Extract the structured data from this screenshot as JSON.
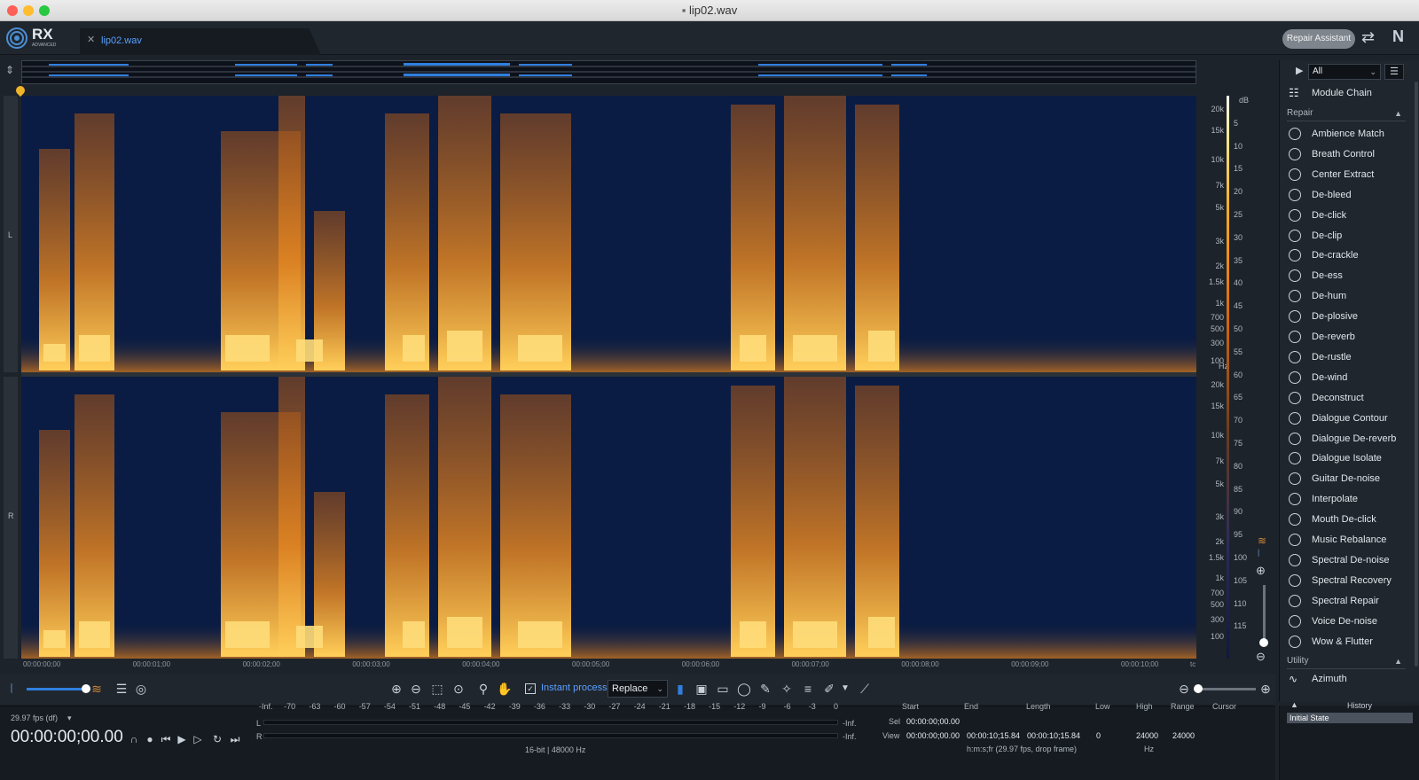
{
  "window": {
    "title": "lip02.wav"
  },
  "header": {
    "logo": "RX",
    "logo_sub": "ADVANCED",
    "tab_label": "lip02.wav",
    "repair_assistant": "Repair Assistant"
  },
  "channels": {
    "left": "L",
    "right": "R"
  },
  "freq_labels": [
    "20k",
    "15k",
    "10k",
    "7k",
    "5k",
    "3k",
    "2k",
    "1.5k",
    "1k",
    "700",
    "500",
    "300",
    "100",
    "Hz"
  ],
  "freq_labels_r": [
    "20k",
    "15k",
    "10k",
    "7k",
    "5k",
    "3k",
    "2k",
    "1.5k",
    "1k",
    "700",
    "500",
    "300",
    "100"
  ],
  "db_labels": [
    "dB",
    "5",
    "10",
    "15",
    "20",
    "25",
    "30",
    "35",
    "40",
    "45",
    "50",
    "55",
    "60",
    "65",
    "70",
    "75",
    "80",
    "85",
    "90",
    "95",
    "100",
    "105",
    "110",
    "115"
  ],
  "time_labels": [
    "00:00:00;00",
    "00:00:01;00",
    "00:00:02;00",
    "00:00:03;00",
    "00:00:04;00",
    "00:00:05;00",
    "00:00:06;00",
    "00:00:07;00",
    "00:00:08;00",
    "00:00:09;00",
    "00:00:10;00",
    "tc"
  ],
  "toolbar": {
    "instant_process": "Instant process",
    "mode": "Replace"
  },
  "transport": {
    "fps": "29.97 fps (df)",
    "timecode": "00:00:00;00.00"
  },
  "meter": {
    "scale": [
      "-Inf.",
      "-70",
      "-63",
      "-60",
      "-57",
      "-54",
      "-51",
      "-48",
      "-45",
      "-42",
      "-39",
      "-36",
      "-33",
      "-30",
      "-27",
      "-24",
      "-21",
      "-18",
      "-15",
      "-12",
      "-9",
      "-6",
      "-3",
      "0"
    ],
    "left": "L",
    "right": "R",
    "left_peak": "-Inf.",
    "right_peak": "-Inf.",
    "format": "16-bit | 48000 Hz"
  },
  "selection": {
    "headers": {
      "start": "Start",
      "end": "End",
      "length": "Length",
      "low": "Low",
      "high": "High",
      "range": "Range",
      "cursor": "Cursor"
    },
    "sel_label": "Sel",
    "view_label": "View",
    "sel_start": "00:00:00;00.00",
    "view_start": "00:00:00;00.00",
    "view_end": "00:00:10;15.84",
    "view_length": "00:00:10;15.84",
    "view_low": "0",
    "view_high": "24000",
    "view_range": "24000",
    "time_format": "h:m:s;fr (29.97 fps, drop frame)",
    "freq_unit": "Hz"
  },
  "right_panel": {
    "filter": "All",
    "module_chain": "Module Chain",
    "repair_header": "Repair",
    "modules": [
      "Ambience Match",
      "Breath Control",
      "Center Extract",
      "De-bleed",
      "De-click",
      "De-clip",
      "De-crackle",
      "De-ess",
      "De-hum",
      "De-plosive",
      "De-reverb",
      "De-rustle",
      "De-wind",
      "Deconstruct",
      "Dialogue Contour",
      "Dialogue De-reverb",
      "Dialogue Isolate",
      "Guitar De-noise",
      "Interpolate",
      "Mouth De-click",
      "Music Rebalance",
      "Spectral De-noise",
      "Spectral Recovery",
      "Spectral Repair",
      "Voice De-noise",
      "Wow & Flutter"
    ],
    "utility_header": "Utility",
    "utility_first": "Azimuth"
  },
  "history": {
    "title": "History",
    "items": [
      "Initial State"
    ]
  }
}
